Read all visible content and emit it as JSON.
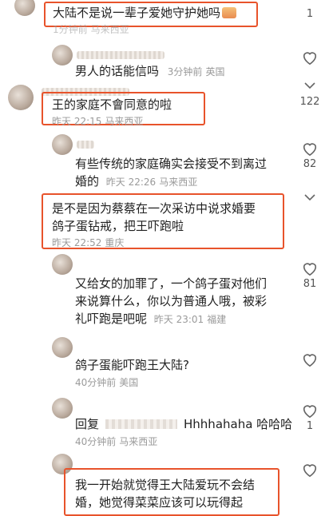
{
  "comments": [
    {
      "id": "c1",
      "text": "大陆不是说一辈子爱她守护她吗",
      "meta": {
        "time": "1分钟前",
        "location": "马来西亚"
      },
      "likes": "1"
    },
    {
      "id": "c2",
      "text": "男人的话能信吗",
      "meta": {
        "time": "3分钟前",
        "location": "英国"
      },
      "likes": ""
    },
    {
      "id": "c3",
      "text": "王的家庭不會同意的啦",
      "meta": {
        "time": "昨天 22:15",
        "location": "马来西亚"
      },
      "likes": "122"
    },
    {
      "id": "c4",
      "text_line1": "有些传统的家庭确实会接受不到离过",
      "text_line2": "婚的",
      "meta": {
        "time": "昨天 22:26",
        "location": "马来西亚"
      },
      "likes": "82"
    },
    {
      "id": "c5",
      "text_line1": "是不是因为蔡蔡在一次采访中说求婚要",
      "text_line2": "鸽子蛋钻戒，把王吓跑啦",
      "meta": {
        "time": "昨天 22:52",
        "location": "重庆"
      },
      "likes": ""
    },
    {
      "id": "c6",
      "text_line1": "又给女的加罪了，一个鸽子蛋对他们",
      "text_line2": "来说算什么，你以为普通人哦，被彩",
      "text_line3": "礼吓跑是吧呢",
      "meta": {
        "time": "昨天 23:01",
        "location": "福建"
      },
      "likes": "81"
    },
    {
      "id": "c7",
      "text": "鸽子蛋能吓跑王大陆?",
      "meta": {
        "time": "40分钟前",
        "location": "美国"
      },
      "likes": ""
    },
    {
      "id": "c8",
      "reply_prefix": "回复",
      "text": "Hhhhahaha 哈哈哈",
      "meta": {
        "time": "40分钟前",
        "location": "马来西亚"
      },
      "likes": "1"
    },
    {
      "id": "c9",
      "text_line1": "我一开始就觉得王大陆爱玩不会结",
      "text_line2": "婚，她觉得菜菜应该可以玩得起",
      "likes": ""
    }
  ],
  "icons": {
    "like": "heart-outline-icon",
    "expand": "chevron-down-icon"
  },
  "colors": {
    "highlight": "#e8532b",
    "meta": "#9a9a9a"
  }
}
